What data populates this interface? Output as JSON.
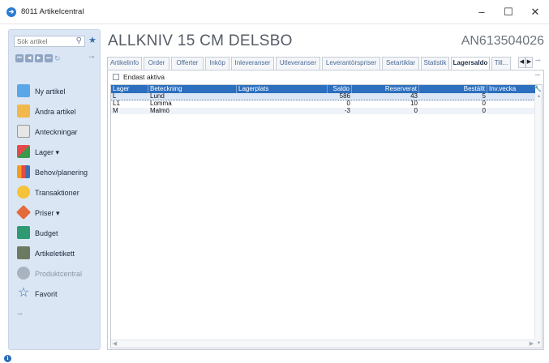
{
  "window": {
    "title": "8011 Artikelcentral",
    "icon": "app-logo-icon",
    "controls": {
      "minimize": "–",
      "maximize": "☐",
      "close": "✕"
    }
  },
  "sidebar": {
    "search": {
      "placeholder": "Sök artikel"
    },
    "items": [
      {
        "label": "Ny artikel",
        "icon": "new-article-icon",
        "color": "#5aa7e8"
      },
      {
        "label": "Ändra artikel",
        "icon": "edit-article-icon",
        "color": "#f2b84b"
      },
      {
        "label": "Anteckningar",
        "icon": "notes-icon",
        "color": "#e6e6e6"
      },
      {
        "label": "Lager ▾",
        "icon": "stock-icon",
        "color": "#e24b4b"
      },
      {
        "label": "Behov/planering",
        "icon": "planning-icon",
        "color": "#f39c1f"
      },
      {
        "label": "Transaktioner",
        "icon": "transactions-icon",
        "color": "#f5c23a"
      },
      {
        "label": "Priser ▾",
        "icon": "price-tag-icon",
        "color": "#e46a3a"
      },
      {
        "label": "Budget",
        "icon": "budget-icon",
        "color": "#2f9a72"
      },
      {
        "label": "Artikeletikett",
        "icon": "label-icon",
        "color": "#6d7a62"
      },
      {
        "label": "Produktcentral",
        "icon": "product-central-icon",
        "color": "#a9b3c0"
      },
      {
        "label": "Favorit",
        "icon": "star-outline-icon",
        "color": "#3a6fb0"
      }
    ]
  },
  "header": {
    "title": "ALLKNIV 15 CM DELSBO",
    "code": "AN613504026"
  },
  "tabs": [
    {
      "label": "Artikelinfo"
    },
    {
      "label": "Order"
    },
    {
      "label": "Offerter"
    },
    {
      "label": "Inköp"
    },
    {
      "label": "Inleveranser"
    },
    {
      "label": "Utleveranser"
    },
    {
      "label": "Leverantörspriser"
    },
    {
      "label": "Setartiklar"
    },
    {
      "label": "Statistik"
    },
    {
      "label": "Lagersaldo"
    },
    {
      "label": "Till..."
    }
  ],
  "active_tab": "Lagersaldo",
  "filter": {
    "label": "Endast aktiva",
    "checked": false
  },
  "table": {
    "columns": [
      "Lager",
      "Beteckning",
      "Lagerplats",
      "Saldo",
      "Reserverat",
      "Beställt",
      "Inv.vecka"
    ],
    "rows": [
      {
        "lager": "L",
        "beteckning": "Lund",
        "lagerplats": "",
        "saldo": "586",
        "reserverat": "43",
        "bestallt": "5",
        "invvecka": ""
      },
      {
        "lager": "L1",
        "beteckning": "Lomma",
        "lagerplats": "",
        "saldo": "0",
        "reserverat": "10",
        "bestallt": "0",
        "invvecka": ""
      },
      {
        "lager": "M",
        "beteckning": "Malmö",
        "lagerplats": "",
        "saldo": "-3",
        "reserverat": "0",
        "bestallt": "0",
        "invvecka": ""
      }
    ]
  },
  "colors": {
    "accent": "#2c6fbf",
    "sidebar_bg": "#dbe6f4",
    "selected_row": "#dbe7f6"
  }
}
